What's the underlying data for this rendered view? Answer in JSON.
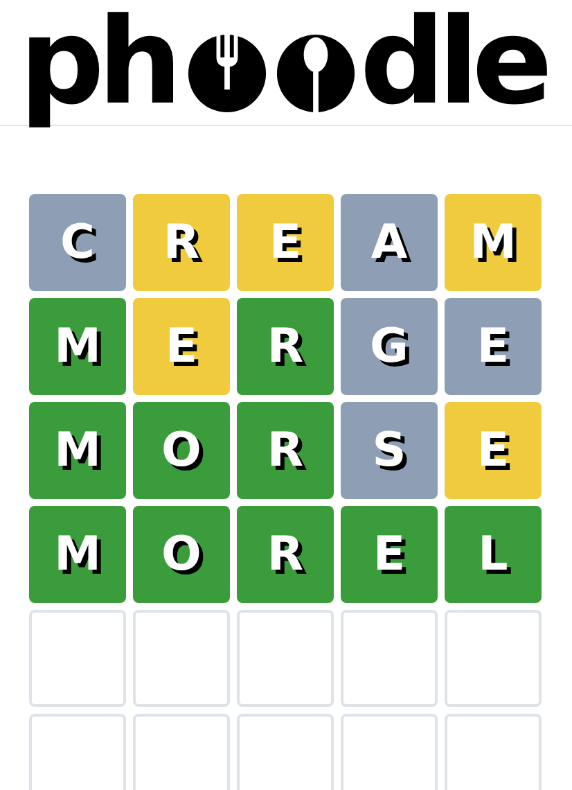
{
  "logo": {
    "before": "ph",
    "after": "dle"
  },
  "board": {
    "rows": [
      {
        "tiles": [
          {
            "letter": "C",
            "kind": "filled",
            "color": "#8e9fb5"
          },
          {
            "letter": "R",
            "kind": "filled",
            "color": "#f0cb3d"
          },
          {
            "letter": "E",
            "kind": "filled",
            "color": "#f0cb3d"
          },
          {
            "letter": "A",
            "kind": "filled",
            "color": "#8e9fb5"
          },
          {
            "letter": "M",
            "kind": "filled",
            "color": "#f0cb3d"
          }
        ]
      },
      {
        "tiles": [
          {
            "letter": "M",
            "kind": "filled",
            "color": "#3a9c3a"
          },
          {
            "letter": "E",
            "kind": "filled",
            "color": "#f0cb3d"
          },
          {
            "letter": "R",
            "kind": "filled",
            "color": "#3a9c3a"
          },
          {
            "letter": "G",
            "kind": "filled",
            "color": "#8e9fb5"
          },
          {
            "letter": "E",
            "kind": "filled",
            "color": "#8e9fb5"
          }
        ]
      },
      {
        "tiles": [
          {
            "letter": "M",
            "kind": "filled",
            "color": "#3a9c3a"
          },
          {
            "letter": "O",
            "kind": "filled",
            "color": "#3a9c3a"
          },
          {
            "letter": "R",
            "kind": "filled",
            "color": "#3a9c3a"
          },
          {
            "letter": "S",
            "kind": "filled",
            "color": "#8e9fb5"
          },
          {
            "letter": "E",
            "kind": "filled",
            "color": "#f0cb3d"
          }
        ]
      },
      {
        "tiles": [
          {
            "letter": "M",
            "kind": "filled",
            "color": "#3a9c3a"
          },
          {
            "letter": "O",
            "kind": "filled",
            "color": "#3a9c3a"
          },
          {
            "letter": "R",
            "kind": "filled",
            "color": "#3a9c3a"
          },
          {
            "letter": "E",
            "kind": "filled",
            "color": "#3a9c3a"
          },
          {
            "letter": "L",
            "kind": "filled",
            "color": "#3a9c3a"
          }
        ]
      },
      {
        "tiles": [
          {
            "kind": "empty"
          },
          {
            "kind": "empty"
          },
          {
            "kind": "empty"
          },
          {
            "kind": "empty"
          },
          {
            "kind": "empty"
          }
        ]
      },
      {
        "tiles": [
          {
            "kind": "empty"
          },
          {
            "kind": "empty"
          },
          {
            "kind": "empty"
          },
          {
            "kind": "empty"
          },
          {
            "kind": "empty"
          }
        ]
      }
    ]
  }
}
